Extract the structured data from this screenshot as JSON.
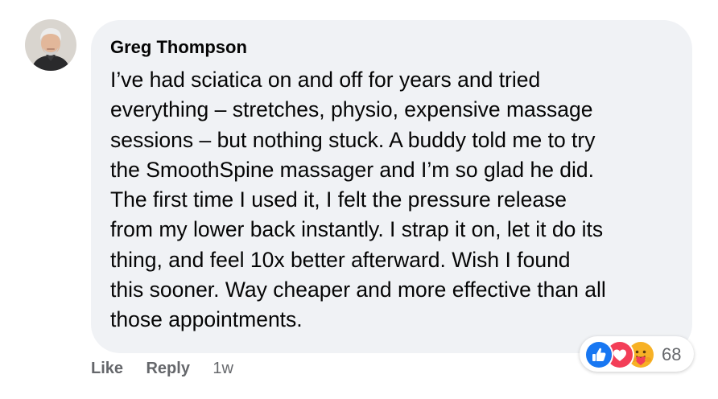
{
  "comment": {
    "author": "Greg Thompson",
    "lines": [
      "I’ve had sciatica on and off for years and tried",
      "everything – stretches, physio, expensive massage",
      "sessions – but nothing stuck. A buddy told me to try",
      "the SmoothSpine massager and I’m so glad he did.",
      "The first time I used it, I felt the pressure release",
      "from my lower back instantly. I strap it on, let it do its",
      "thing, and feel 10x better afterward. Wish I found",
      "this sooner. Way cheaper and more effective than all",
      "those appointments."
    ],
    "reactions": {
      "icons": [
        "like-icon",
        "love-icon",
        "care-icon"
      ],
      "count": "68"
    },
    "actions": {
      "like_label": "Like",
      "reply_label": "Reply",
      "timestamp": "1w"
    }
  },
  "colors": {
    "bubble": "#f0f2f5",
    "text": "#050505",
    "muted": "#65676b",
    "like_blue": "#1877f2",
    "love_red": "#f33e58",
    "care_yellow": "#f7b125"
  }
}
